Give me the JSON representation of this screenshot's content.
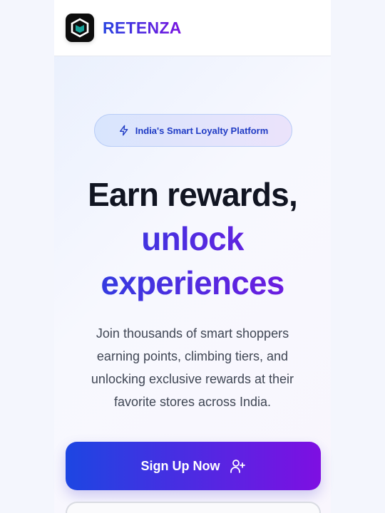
{
  "header": {
    "brand": "RETENZA",
    "logo_icon": "hexagon-book-logo"
  },
  "hero": {
    "badge": {
      "icon": "lightning-icon",
      "label": "India's Smart Loyalty Platform"
    },
    "title_line1": "Earn rewards,",
    "title_line2": "unlock experiences",
    "description": "Join thousands of smart shoppers earning points, climbing tiers, and unlocking exclusive rewards at their favorite stores across India.",
    "cta": {
      "label": "Sign Up Now",
      "icon": "user-plus-icon"
    }
  },
  "colors": {
    "brand_start": "#1d46e2",
    "brand_end": "#7e0fe2",
    "heading": "#111522"
  }
}
